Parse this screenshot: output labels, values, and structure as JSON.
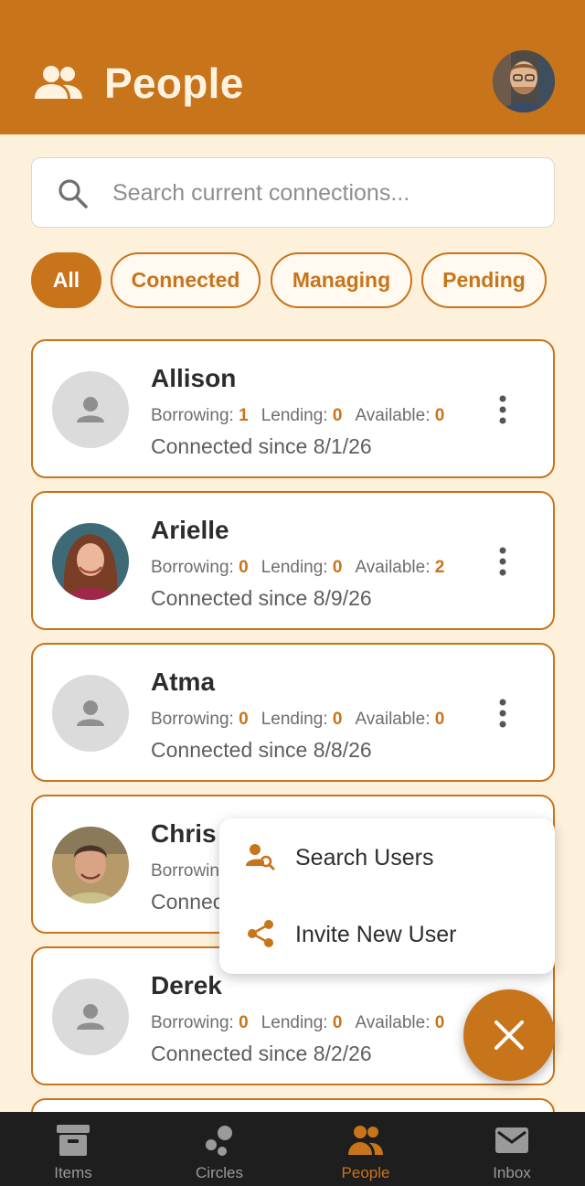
{
  "header": {
    "title": "People",
    "icon": "people-icon"
  },
  "search": {
    "placeholder": "Search current connections...",
    "value": "",
    "icon": "search-icon"
  },
  "filters": [
    {
      "label": "All",
      "active": true
    },
    {
      "label": "Connected",
      "active": false
    },
    {
      "label": "Managing",
      "active": false
    },
    {
      "label": "Pending",
      "active": false
    }
  ],
  "stat_labels": {
    "borrowing": "Borrowing:",
    "lending": "Lending:",
    "available": "Available:"
  },
  "people": [
    {
      "name": "Allison",
      "borrowing": "1",
      "lending": "0",
      "available": "0",
      "since": "Connected since 8/1/26",
      "avatar": "default-avatar-icon"
    },
    {
      "name": "Arielle",
      "borrowing": "0",
      "lending": "0",
      "available": "2",
      "since": "Connected since 8/9/26",
      "avatar": "photo"
    },
    {
      "name": "Atma",
      "borrowing": "0",
      "lending": "0",
      "available": "0",
      "since": "Connected since 8/8/26",
      "avatar": "default-avatar-icon"
    },
    {
      "name": "Chris",
      "borrowing": "",
      "lending": "",
      "available": "",
      "since": "Connec",
      "visible_stats": "Borrowin",
      "avatar": "photo"
    },
    {
      "name": "Derek",
      "borrowing": "0",
      "lending": "0",
      "available": "0",
      "since": "Connected since 8/2/26",
      "avatar": "default-avatar-icon"
    }
  ],
  "fab_menu": {
    "items": [
      {
        "label": "Search Users",
        "icon": "search-user-icon"
      },
      {
        "label": "Invite New User",
        "icon": "share-icon"
      }
    ]
  },
  "fab": {
    "icon": "close-icon"
  },
  "bottom_nav": {
    "items": [
      {
        "label": "Items",
        "icon": "archive-box-icon",
        "active": false
      },
      {
        "label": "Circles",
        "icon": "circles-icon",
        "active": false
      },
      {
        "label": "People",
        "icon": "people-icon",
        "active": true
      },
      {
        "label": "Inbox",
        "icon": "mail-icon",
        "active": false
      }
    ]
  },
  "colors": {
    "accent": "#C8741B",
    "background": "#FDF1DB",
    "nav_background": "#1E1E1E"
  }
}
